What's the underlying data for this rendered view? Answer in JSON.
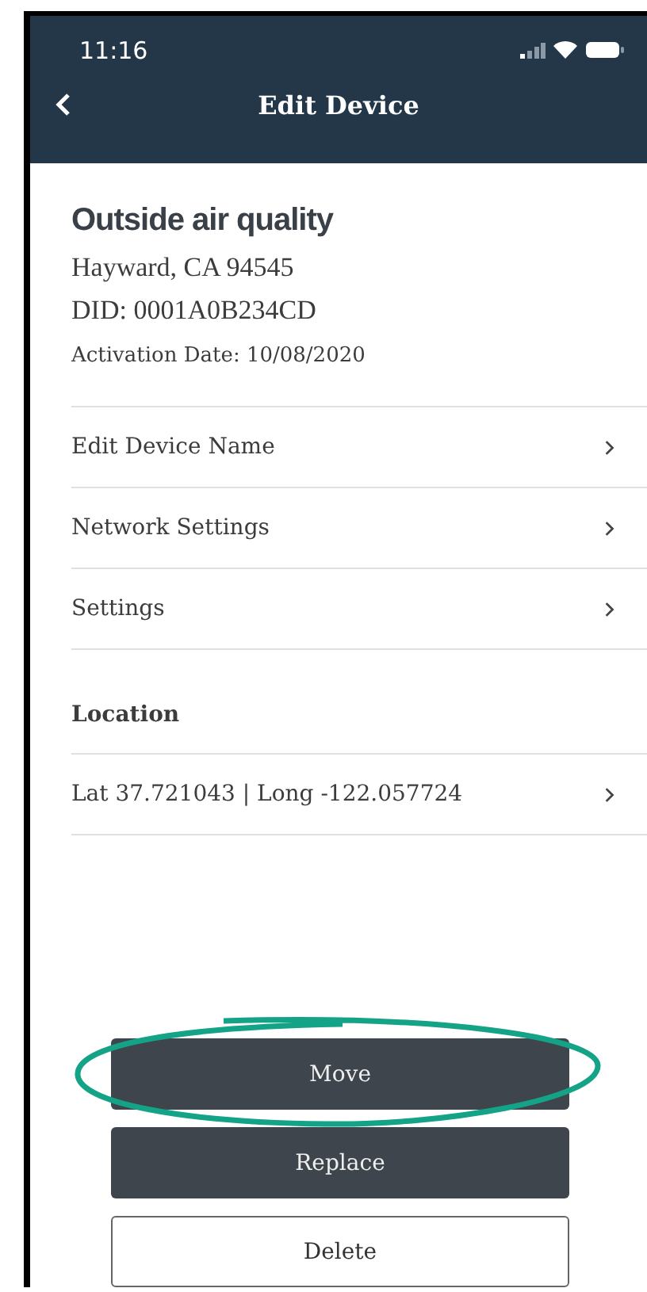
{
  "status_bar": {
    "time": "11:16"
  },
  "header": {
    "title": "Edit Device"
  },
  "device": {
    "name": "Outside air quality",
    "address": "Hayward, CA 94545",
    "did": "DID: 0001A0B234CD",
    "activation": "Activation Date: 10/08/2020"
  },
  "menu": [
    {
      "label": "Edit Device Name"
    },
    {
      "label": "Network Settings"
    },
    {
      "label": "Settings"
    }
  ],
  "location": {
    "heading": "Location",
    "value": "Lat 37.721043 | Long -122.057724"
  },
  "buttons": [
    {
      "label": "Move",
      "kind": "filled",
      "highlighted": true
    },
    {
      "label": "Replace",
      "kind": "filled",
      "highlighted": false
    },
    {
      "label": "Delete",
      "kind": "outline",
      "highlighted": false
    }
  ]
}
